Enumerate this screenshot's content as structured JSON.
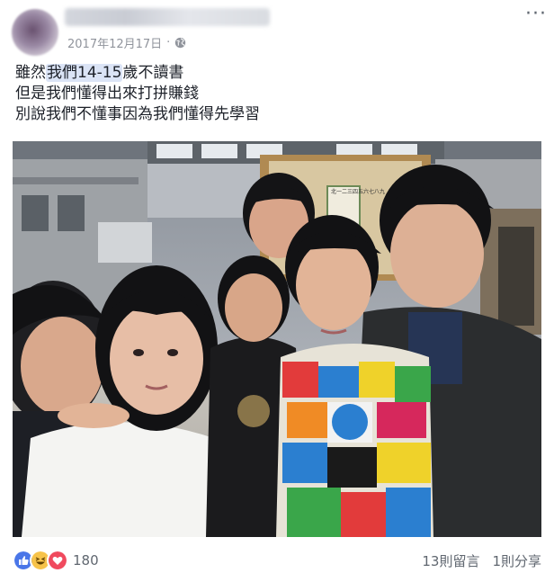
{
  "post": {
    "date": "2017年12月17日",
    "separator": "·",
    "lines": {
      "line1_pre": "雖然",
      "line1_highlight": "我們14-15",
      "line1_post": "歲不讀書",
      "line2": "但是我們懂得出來打拼賺錢",
      "line3": "別說我們不懂事因為我們懂得先學習"
    }
  },
  "photo": {
    "sign_text": "北一二三四五六七八九"
  },
  "footer": {
    "reaction_count": "180",
    "comments": "13則留言",
    "shares": "1則分享"
  },
  "colors": {
    "like": "#4a76e8",
    "haha": "#f7c34a",
    "love": "#f04a5e",
    "meta": "#90949c"
  }
}
